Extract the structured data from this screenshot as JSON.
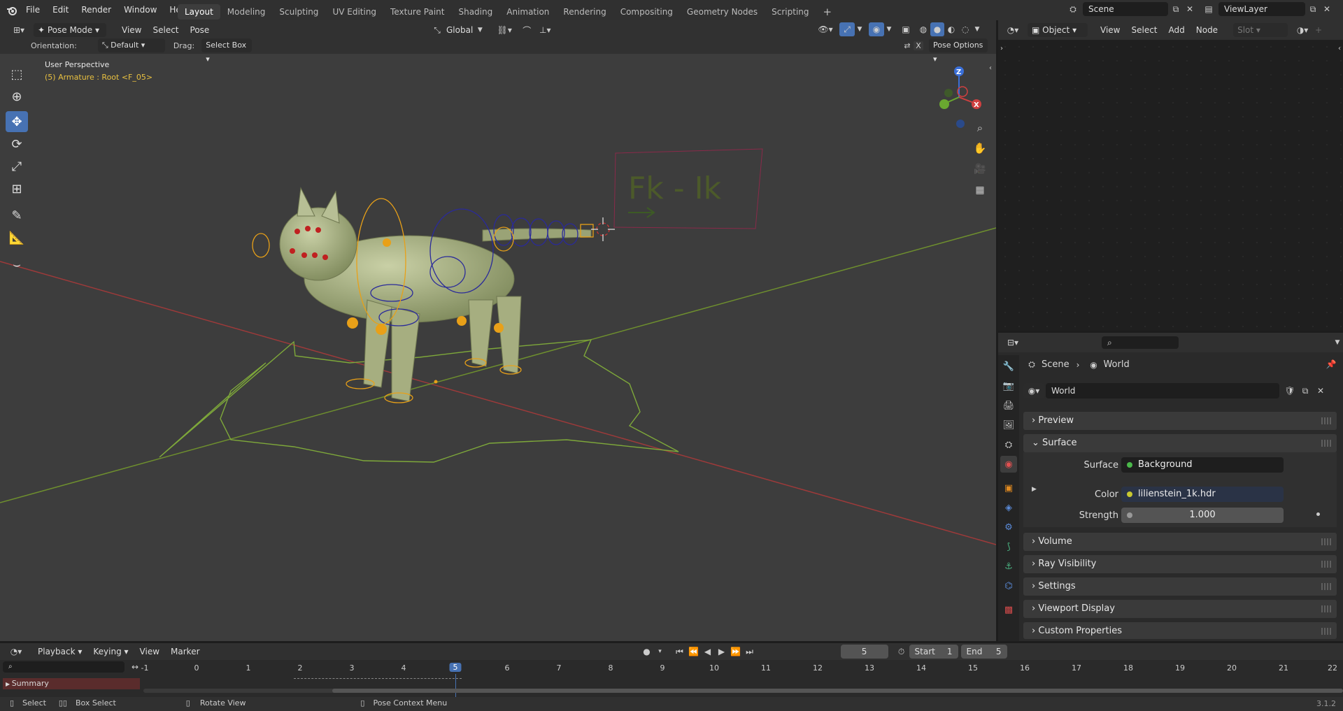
{
  "topbar": {
    "menus": [
      "File",
      "Edit",
      "Render",
      "Window",
      "Help"
    ],
    "workspaces": [
      "Layout",
      "Modeling",
      "Sculpting",
      "UV Editing",
      "Texture Paint",
      "Shading",
      "Animation",
      "Rendering",
      "Compositing",
      "Geometry Nodes",
      "Scripting"
    ],
    "active_workspace": "Layout",
    "add_tab": "+",
    "scene": "Scene",
    "view_layer": "ViewLayer"
  },
  "viewport_header": {
    "mode": "Pose Mode",
    "menus": [
      "View",
      "Select",
      "Pose"
    ],
    "transform_orientation": "Global",
    "orientation_label": "Orientation:",
    "orientation_value": "Default",
    "drag_label": "Drag:",
    "drag_value": "Select Box",
    "pose_options": "Pose Options"
  },
  "viewport": {
    "view_name": "User Perspective",
    "object_info": "(5) Armature : Root <F_05>",
    "rig_label": "Fk  -  Ik",
    "gizmo_axes": [
      "Z",
      "X",
      "Y"
    ]
  },
  "node_editor_header": {
    "object_mode": "Object",
    "menus": [
      "View",
      "Select",
      "Add",
      "Node"
    ],
    "slot": "Slot"
  },
  "properties": {
    "breadcrumb": [
      "Scene",
      "World"
    ],
    "world_name": "World",
    "panels": {
      "preview": "Preview",
      "surface": "Surface",
      "volume": "Volume",
      "ray_visibility": "Ray Visibility",
      "settings": "Settings",
      "viewport_display": "Viewport Display",
      "custom_properties": "Custom Properties"
    },
    "surface_label": "Surface",
    "surface_value": "Background",
    "color_label": "Color",
    "color_value": "lilienstein_1k.hdr",
    "strength_label": "Strength",
    "strength_value": "1.000"
  },
  "timeline": {
    "menus": [
      "Playback",
      "Keying",
      "View",
      "Marker"
    ],
    "current_frame": "5",
    "start_label": "Start",
    "start_value": "1",
    "end_label": "End",
    "end_value": "5",
    "frames": [
      "-1",
      "0",
      "1",
      "2",
      "3",
      "4",
      "5",
      "6",
      "7",
      "8",
      "9",
      "10",
      "11",
      "12",
      "13",
      "14",
      "15",
      "16",
      "17",
      "18",
      "19",
      "20",
      "21",
      "22"
    ],
    "summary": "Summary"
  },
  "statusbar": {
    "select": "Select",
    "box_select": "Box Select",
    "rotate_view": "Rotate View",
    "context_menu": "Pose Context Menu",
    "version": "3.1.2"
  },
  "colors": {
    "accent": "#4772b3",
    "active_frame": "#4772b3",
    "axis_x": "#c23b3b",
    "axis_y": "#7ea83a",
    "bone_orange": "#e8a018",
    "bone_blue": "#2a2a9a"
  }
}
